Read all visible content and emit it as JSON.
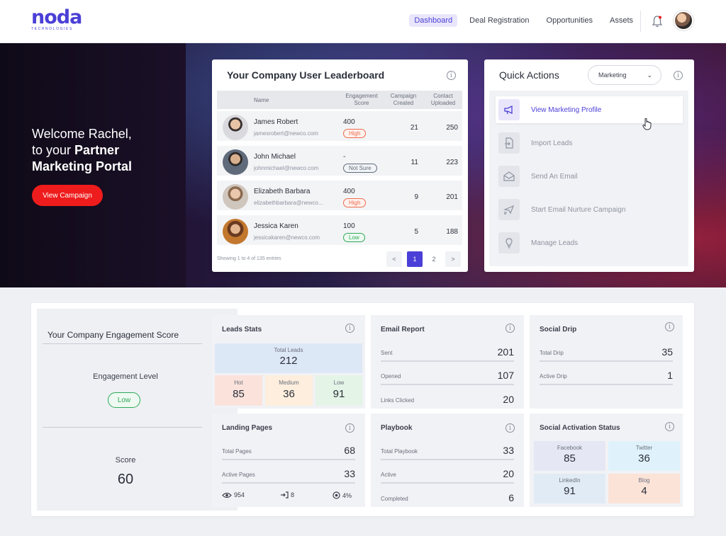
{
  "brand": {
    "name": "noda",
    "tagline": "TECHNOLOGIES"
  },
  "nav": {
    "items": [
      "Dashboard",
      "Deal Registration",
      "Opportunities",
      "Assets"
    ],
    "active": "Dashboard"
  },
  "hero": {
    "welcome_line1": "Welcome Rachel,",
    "welcome_line2_prefix": "to your",
    "welcome_line2_bold": "Partner",
    "welcome_line3": "Marketing Portal",
    "cta_label": "View Campaign"
  },
  "leaderboard": {
    "title": "Your Company User Leaderboard",
    "columns": [
      "Name",
      "Engagement Score",
      "Campaign Created",
      "Contact Uploaded"
    ],
    "rows": [
      {
        "name": "James Robert",
        "email": "jamesrobert@newco.com",
        "score": "400",
        "badge": "High",
        "campaigns": "21",
        "contacts": "250"
      },
      {
        "name": "John Michael",
        "email": "johnmichael@newco.com",
        "score": "-",
        "badge": "Not Sure",
        "campaigns": "11",
        "contacts": "223"
      },
      {
        "name": "Elizabeth Barbara",
        "email": "elizabethbarbara@newco...",
        "score": "400",
        "badge": "High",
        "campaigns": "9",
        "contacts": "201"
      },
      {
        "name": "Jessica Karen",
        "email": "jessicakaren@newco.com",
        "score": "100",
        "badge": "Low",
        "campaigns": "5",
        "contacts": "188"
      }
    ],
    "footer": "Showing 1 to 4 of 135 entries",
    "pages": [
      "<",
      "1",
      "2",
      ">"
    ]
  },
  "quick_actions": {
    "title": "Quick Actions",
    "filter": "Marketing",
    "items": [
      "View Marketing Profile",
      "Import Leads",
      "Send An Email",
      "Start Email Nurture Campaign",
      "Manage Leads"
    ]
  },
  "engagement": {
    "title": "Your Company Engagement Score",
    "level_label": "Engagement Level",
    "level": "Low",
    "score_label": "Score",
    "score": "60"
  },
  "leads_stats": {
    "title": "Leads Stats",
    "total_label": "Total Leads",
    "total": "212",
    "hot_label": "Hot",
    "hot": "85",
    "medium_label": "Medium",
    "medium": "36",
    "low_label": "Low",
    "low": "91"
  },
  "email_report": {
    "title": "Email Report",
    "rows": [
      {
        "label": "Sent",
        "value": "201"
      },
      {
        "label": "Opened",
        "value": "107"
      },
      {
        "label": "Links Clicked",
        "value": "20"
      }
    ]
  },
  "social_drip": {
    "title": "Social Drip",
    "rows": [
      {
        "label": "Total Drip",
        "value": "35"
      },
      {
        "label": "Active Drip",
        "value": "1"
      }
    ]
  },
  "landing_pages": {
    "title": "Landing Pages",
    "rows": [
      {
        "label": "Total Pages",
        "value": "68"
      },
      {
        "label": "Active Pages",
        "value": "33"
      }
    ],
    "views": "954",
    "entries": "8",
    "rate": "4%"
  },
  "playbook": {
    "title": "Playbook",
    "rows": [
      {
        "label": "Total Playbook",
        "value": "33"
      },
      {
        "label": "Active",
        "value": "20"
      },
      {
        "label": "Completed",
        "value": "6"
      }
    ]
  },
  "social_activation": {
    "title": "Social Activation Status",
    "facebook_label": "Facebook",
    "facebook": "85",
    "twitter_label": "Twitter",
    "twitter": "36",
    "linkedin_label": "LinkedIn",
    "linkedin": "91",
    "blog_label": "Blog",
    "blog": "4"
  },
  "colors": {
    "brand": "#4a3fd6",
    "cta": "#ee1c1c",
    "high": "#ec6a4c",
    "low": "#2fa85a"
  }
}
